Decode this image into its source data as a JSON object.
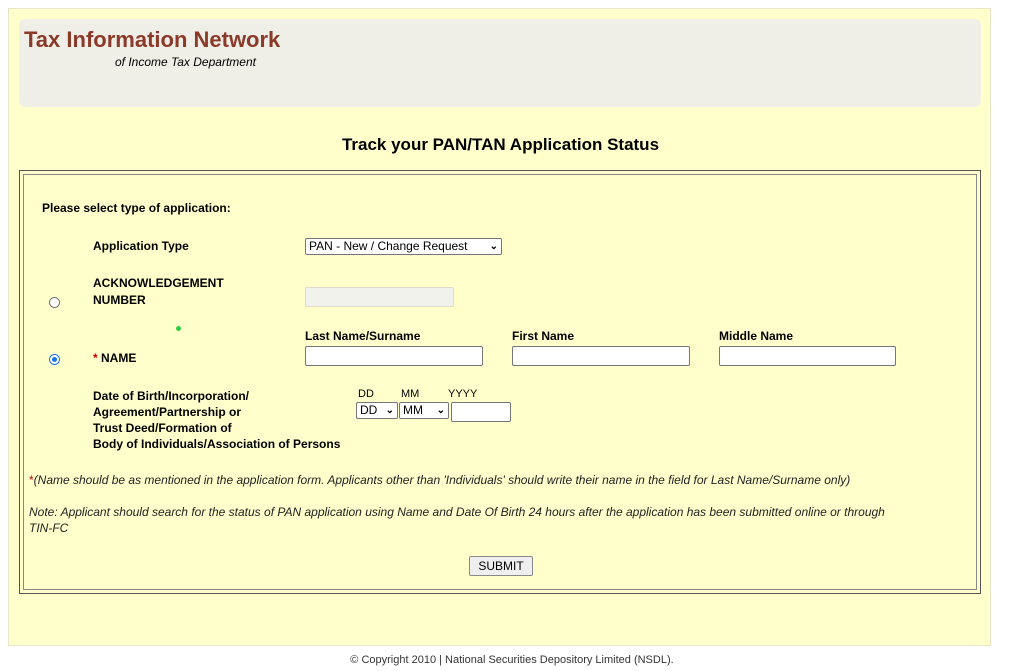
{
  "header": {
    "title": "Tax Information Network",
    "subtitle": "of Income Tax Department"
  },
  "page": {
    "heading": "Track your PAN/TAN Application Status"
  },
  "form": {
    "select_type_label": "Please select type of application:",
    "application_type_label": "Application Type",
    "application_type_value": "PAN - New / Change Request",
    "ack_label_line1": "ACKNOWLEDGEMENT",
    "ack_label_line2": "NUMBER",
    "ack_selected": false,
    "name_required_mark": "*",
    "name_label": "NAME",
    "name_selected": true,
    "last_name_header": "Last Name/Surname",
    "first_name_header": "First Name",
    "middle_name_header": "Middle Name",
    "dob_label_line1": "Date of Birth/Incorporation/",
    "dob_label_line2": "Agreement/Partnership or",
    "dob_label_line3": "Trust Deed/Formation of",
    "dob_label_line4": "Body of Individuals/Association of Persons",
    "dd_header": "DD",
    "mm_header": "MM",
    "yyyy_header": "YYYY",
    "dd_value": "DD",
    "mm_value": "MM",
    "note1_mark": "*",
    "note1": "(Name should be as mentioned in the application form. Applicants other than 'Individuals' should write their name in the field for Last Name/Surname only)",
    "note2_line1": "Note: Applicant should search for the status of PAN application using Name and Date Of Birth 24 hours after the application has been submitted online or through",
    "note2_line2": "TIN-FC",
    "submit_label": "SUBMIT"
  },
  "footer": {
    "copyright": "© Copyright 2010  |  National Securities Depository Limited (NSDL)."
  }
}
